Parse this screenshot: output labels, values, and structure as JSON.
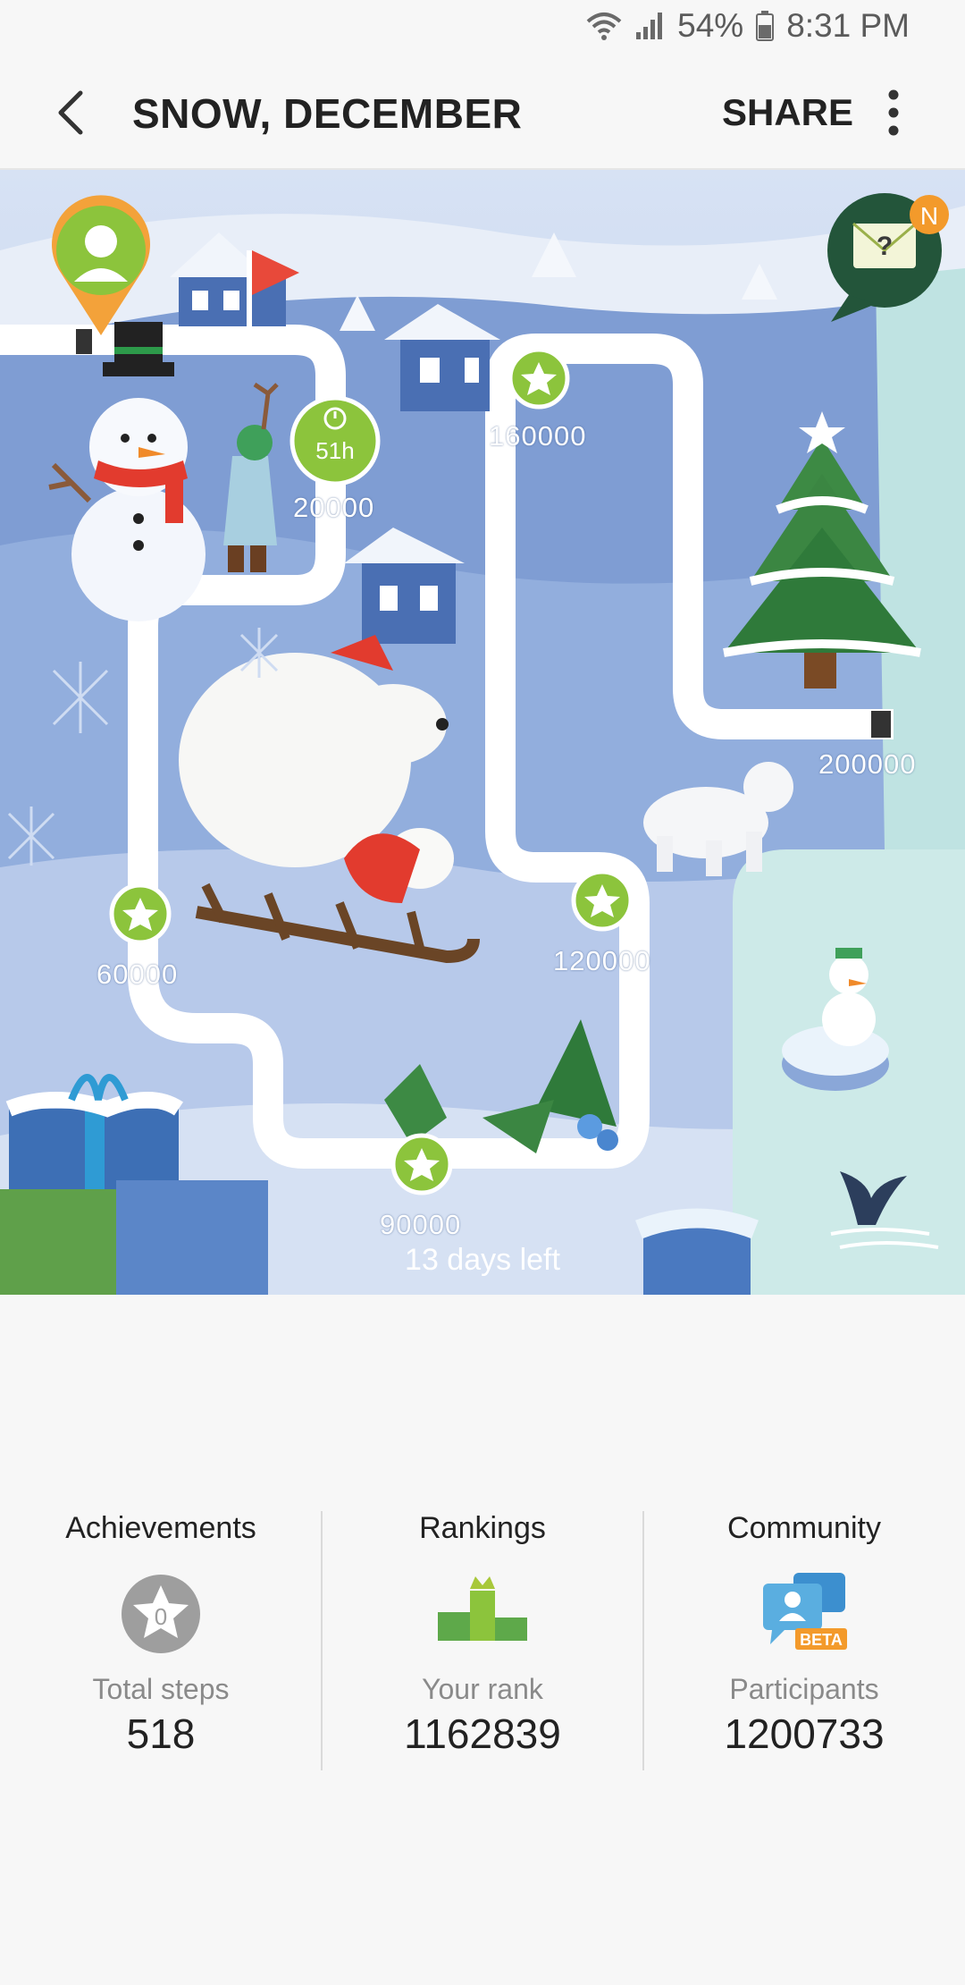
{
  "status": {
    "battery": "54%",
    "time": "8:31 PM"
  },
  "appbar": {
    "title": "SNOW, DECEMBER",
    "share_label": "SHARE"
  },
  "map": {
    "timer_label": "51h",
    "notification_badge": "N",
    "mail_symbol": "?",
    "milestones": [
      "20000",
      "60000",
      "90000",
      "120000",
      "160000",
      "200000"
    ],
    "days_left": "13 days left"
  },
  "stats": {
    "achievements": {
      "header": "Achievements",
      "badge": "0",
      "label": "Total steps",
      "value": "518"
    },
    "rankings": {
      "header": "Rankings",
      "label": "Your rank",
      "value": "1162839"
    },
    "community": {
      "header": "Community",
      "badge": "BETA",
      "label": "Participants",
      "value": "1200733"
    }
  },
  "colors": {
    "accent_green": "#8cc43c",
    "map_blue": "#8ea9d8",
    "badge_orange": "#f39a2b"
  }
}
